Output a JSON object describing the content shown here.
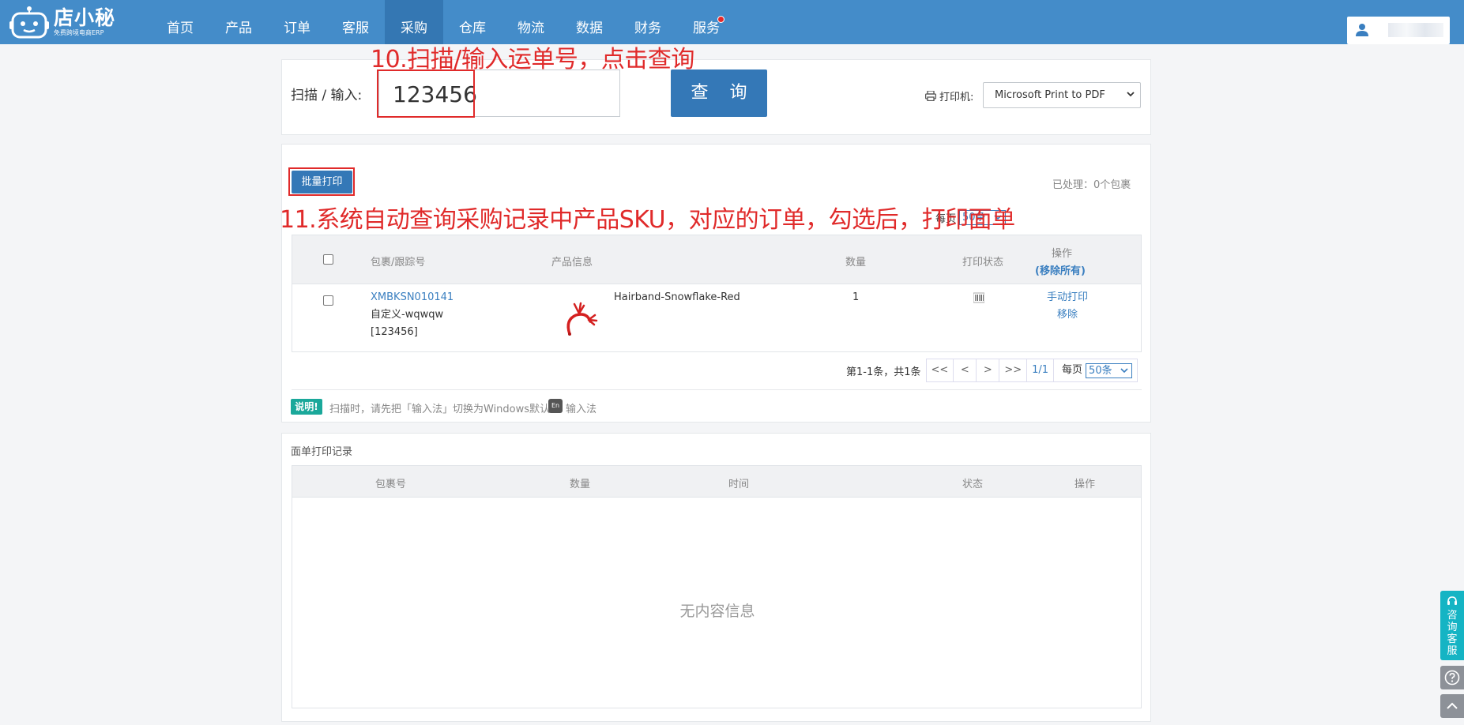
{
  "brand": {
    "name": "店小秘",
    "subtitle": "免费跨境电商ERP"
  },
  "nav": {
    "items": [
      {
        "label": "首页"
      },
      {
        "label": "产品"
      },
      {
        "label": "订单"
      },
      {
        "label": "客服"
      },
      {
        "label": "采购",
        "active": true
      },
      {
        "label": "仓库"
      },
      {
        "label": "物流"
      },
      {
        "label": "数据"
      },
      {
        "label": "财务"
      },
      {
        "label": "服务",
        "badge_dot": true
      }
    ],
    "active_color": "#3477b3",
    "bar_color": "#448cc9"
  },
  "user": {
    "icon": "user-icon"
  },
  "scan": {
    "label": "扫描 / 输入:",
    "value": "123456",
    "query_label": "查 询"
  },
  "printer": {
    "label": "打印机:",
    "selected": "Microsoft Print to PDF",
    "icon": "printer-icon"
  },
  "batch": {
    "print_label": "批量打印",
    "processed": "已处理：0个包裹"
  },
  "pager_top": {
    "per_page_label": "每页",
    "per_page": "50条"
  },
  "table": {
    "headers": {
      "package": "包裹/跟踪号",
      "product": "产品信息",
      "qty": "数量",
      "print_status": "打印状态",
      "action": "操作",
      "remove_all": "(移除所有)"
    },
    "rows": [
      {
        "package_no": "XMBKSN010141",
        "custom": "自定义-wqwqw",
        "tracking": "[123456]",
        "product_name": "Hairband-Snowflake-Red",
        "qty": "1",
        "print_status_icon": "barcode-icon",
        "action_manual": "手动打印",
        "action_remove": "移除"
      }
    ]
  },
  "pager_bottom": {
    "summary": "第1-1条，共1条",
    "first": "<<",
    "prev": "<",
    "next": ">",
    "last": ">>",
    "current": "1/1",
    "per_page_label": "每页",
    "per_page": "50条"
  },
  "note": {
    "badge": "说明!",
    "text1": "扫描时，请先把「输入法」切换为Windows默认",
    "en": "En",
    "text2": "输入法"
  },
  "records": {
    "title": "面单打印记录",
    "headers": {
      "package": "包裹号",
      "qty": "数量",
      "time": "时间",
      "status": "状态",
      "action": "操作"
    },
    "empty": "无内容信息"
  },
  "annotations": {
    "step10": "10.扫描/输入运单号，点击查询",
    "step11": "11.系统自动查询采购记录中产品SKU，对应的订单，勾选后，打印面单"
  },
  "side": {
    "consult": "咨询客服",
    "help_icon": "help-icon",
    "top_icon": "back-to-top-icon"
  }
}
